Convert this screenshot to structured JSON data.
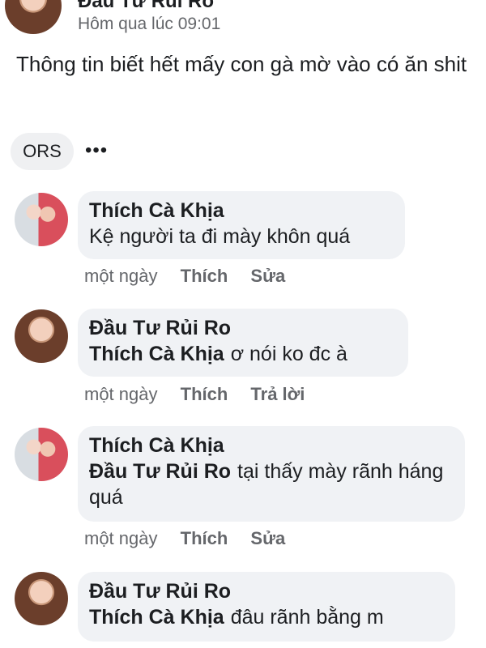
{
  "post": {
    "author": "Đầu Tư Rủi Ro",
    "time": "Hôm qua lúc 09:01",
    "text": "Thông tin biết hết mấy con gà mờ vào có ăn shit",
    "reaction_label": "ORS",
    "more_icon": "more-icon"
  },
  "comments": [
    {
      "author": "Thích Cà Khịa",
      "mention": "",
      "text": "Kệ người ta đi mày khôn quá",
      "time": "một ngày",
      "like": "Thích",
      "action": "Sửa"
    },
    {
      "author": "Đầu Tư Rủi Ro",
      "mention": "Thích Cà Khịa",
      "text": "ơ nói ko đc à",
      "time": "một ngày",
      "like": "Thích",
      "action": "Trả lời"
    },
    {
      "author": "Thích Cà Khịa",
      "mention": "Đầu Tư Rủi Ro",
      "text": "tại thấy mày rãnh háng quá",
      "time": "một ngày",
      "like": "Thích",
      "action": "Sửa"
    },
    {
      "author": "Đầu Tư Rủi Ro",
      "mention": "Thích Cà Khịa",
      "text": "đâu rãnh bằng m",
      "time": "",
      "like": "",
      "action": ""
    }
  ],
  "colors": {
    "bubble": "#f0f2f5",
    "secondary_text": "#65676b",
    "primary_text": "#1c1e21"
  }
}
